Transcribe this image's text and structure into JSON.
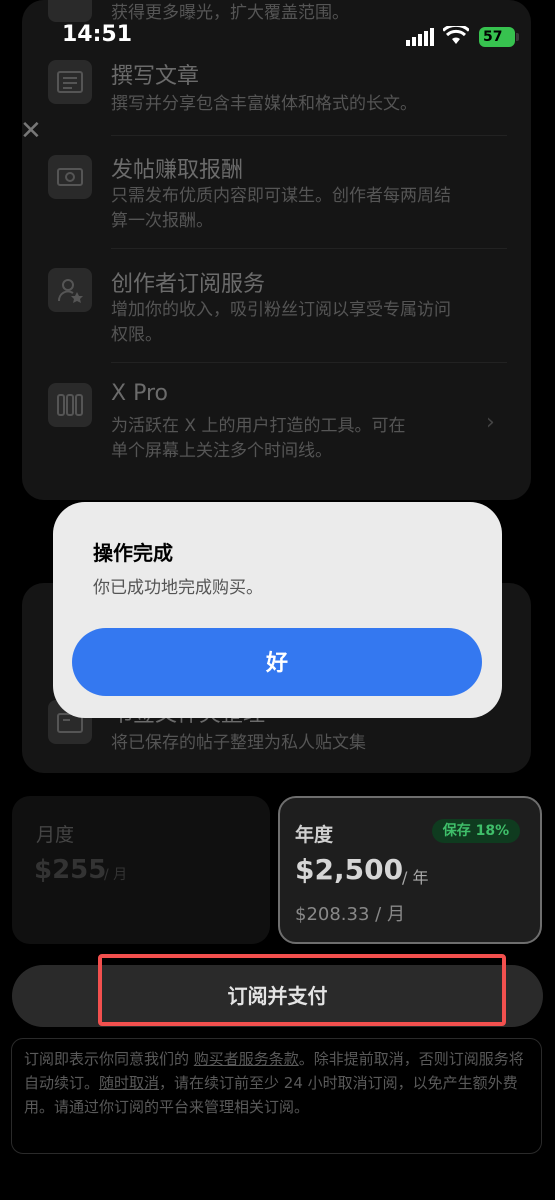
{
  "status": {
    "time": "14:51",
    "battery": "57"
  },
  "features": [
    {
      "title": "",
      "desc": "获得更多曝光，扩大覆盖范围。",
      "icon": "play-icon"
    },
    {
      "title": "撰写文章",
      "desc": "撰写并分享包含丰富媒体和格式的长文。",
      "icon": "article-icon"
    },
    {
      "title": "发帖赚取报酬",
      "desc": "只需发布优质内容即可谋生。创作者每两周结",
      "desc2": "算一次报酬。",
      "icon": "money-icon"
    },
    {
      "title": "创作者订阅服务",
      "desc": "增加你的收入，吸引粉丝订阅以享受专属访问",
      "desc2": "权限。",
      "icon": "subscriber-star-icon"
    },
    {
      "title": "X Pro",
      "desc": "为活跃在 X 上的用户打造的工具。可在",
      "desc2": "单个屏幕上关注多个时间线。",
      "icon": "columns-icon"
    }
  ],
  "bookmark_feature": {
    "title": "书签文件夹整理",
    "desc": "将已保存的帖子整理为私人贴文集"
  },
  "alert": {
    "title": "操作完成",
    "message": "你已成功地完成购买。",
    "button": "好"
  },
  "plans": {
    "monthly": {
      "label": "月度",
      "price": "$255",
      "unit": "/ 月"
    },
    "annual": {
      "label": "年度",
      "badge": "保存 18%",
      "price": "$2,500",
      "unit": "/ 年",
      "per_month": "$208.33 / 月"
    }
  },
  "subscribe_button": "订阅并支付",
  "legal": {
    "p1": "订阅即表示你同意我们的 ",
    "link1": "购买者服务条款",
    "p2": "。除非提前取消，否则订阅服务将自动续订。",
    "link2": "随时取消",
    "p3": "，请在续订前至少 24 小时取消订阅，以免产生额外费用。请通过你订阅的平台来管理相关订阅。"
  }
}
